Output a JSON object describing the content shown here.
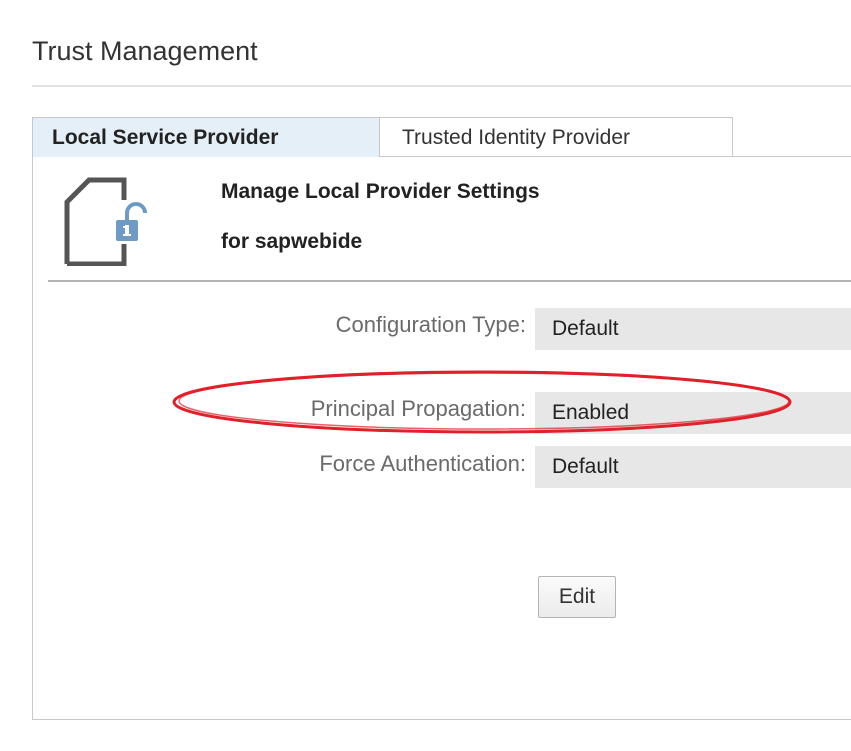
{
  "page": {
    "title": "Trust Management"
  },
  "tabs": [
    {
      "label": "Local Service Provider",
      "active": true
    },
    {
      "label": "Trusted Identity Provider",
      "active": false
    }
  ],
  "header": {
    "icon": "document-unlocked-icon",
    "title": "Manage Local Provider Settings",
    "subtitle": "for sapwebide"
  },
  "fields": [
    {
      "label": "Configuration Type:",
      "value": "Default"
    },
    {
      "label": "Principal Propagation:",
      "value": "Enabled",
      "highlighted": true
    },
    {
      "label": "Force Authentication:",
      "value": "Default"
    }
  ],
  "actions": {
    "edit_label": "Edit"
  },
  "colors": {
    "active_tab_bg": "#e5eff7",
    "field_bg": "#e7e7e7",
    "icon_lock": "#6e9ac4",
    "highlight_ellipse": "#e0202a"
  }
}
